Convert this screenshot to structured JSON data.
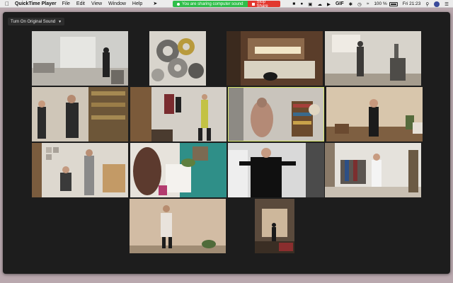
{
  "menubar": {
    "app_name": "QuickTime Player",
    "items": [
      "File",
      "Edit",
      "View",
      "Window",
      "Help"
    ],
    "sharing_text": "You are sharing computer sound",
    "stop_share_label": "Stop Share",
    "battery_text": "100 %",
    "clock": "Fri 21:23",
    "gif_label": "GIF"
  },
  "window": {
    "original_sound_label": "Turn On Original Sound"
  },
  "accent": {
    "active_speaker_border": "#d8e66a",
    "share_green": "#2fbf4a",
    "stop_red": "#e2382f"
  }
}
